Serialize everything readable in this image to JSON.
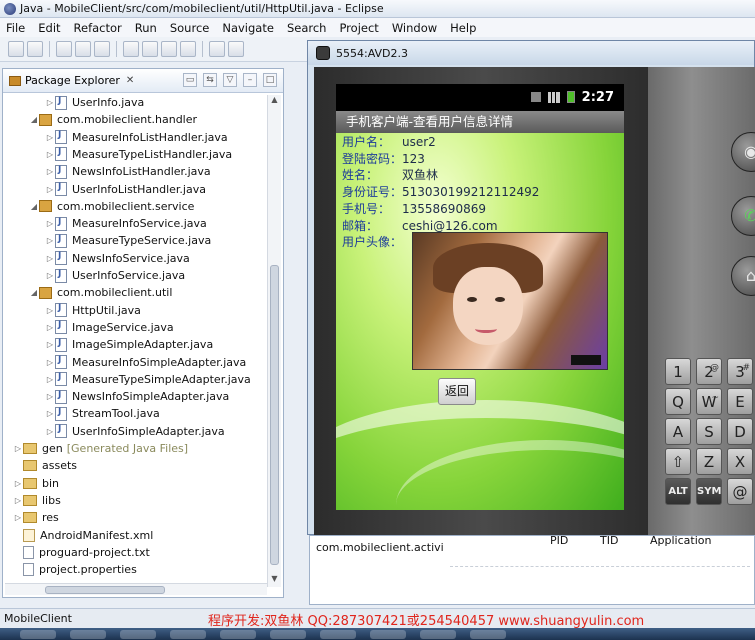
{
  "window": {
    "title": "Java - MobileClient/src/com/mobileclient/util/HttpUtil.java - Eclipse"
  },
  "menu": [
    "File",
    "Edit",
    "Refactor",
    "Run",
    "Source",
    "Navigate",
    "Search",
    "Project",
    "Window",
    "Help"
  ],
  "explorer": {
    "tab_label": "Package Explorer",
    "close_glyph": "✕",
    "items": [
      {
        "text": "UserInfo.java",
        "icon": "java-file-icon",
        "indent": 3
      },
      {
        "text": "com.mobileclient.handler",
        "icon": "package-icon",
        "indent": 2,
        "expanded": true
      },
      {
        "text": "MeasureInfoListHandler.java",
        "icon": "java-file-icon",
        "indent": 3
      },
      {
        "text": "MeasureTypeListHandler.java",
        "icon": "java-file-icon",
        "indent": 3
      },
      {
        "text": "NewsInfoListHandler.java",
        "icon": "java-file-icon",
        "indent": 3
      },
      {
        "text": "UserInfoListHandler.java",
        "icon": "java-file-icon",
        "indent": 3
      },
      {
        "text": "com.mobileclient.service",
        "icon": "package-icon",
        "indent": 2,
        "expanded": true
      },
      {
        "text": "MeasureInfoService.java",
        "icon": "java-file-icon",
        "indent": 3
      },
      {
        "text": "MeasureTypeService.java",
        "icon": "java-file-icon",
        "indent": 3
      },
      {
        "text": "NewsInfoService.java",
        "icon": "java-file-icon",
        "indent": 3
      },
      {
        "text": "UserInfoService.java",
        "icon": "java-file-icon",
        "indent": 3
      },
      {
        "text": "com.mobileclient.util",
        "icon": "package-icon",
        "indent": 2,
        "expanded": true
      },
      {
        "text": "HttpUtil.java",
        "icon": "java-file-icon",
        "indent": 3
      },
      {
        "text": "ImageService.java",
        "icon": "java-file-icon",
        "indent": 3
      },
      {
        "text": "ImageSimpleAdapter.java",
        "icon": "java-file-icon",
        "indent": 3
      },
      {
        "text": "MeasureInfoSimpleAdapter.java",
        "icon": "java-file-icon",
        "indent": 3
      },
      {
        "text": "MeasureTypeSimpleAdapter.java",
        "icon": "java-file-icon",
        "indent": 3
      },
      {
        "text": "NewsInfoSimpleAdapter.java",
        "icon": "java-file-icon",
        "indent": 3
      },
      {
        "text": "StreamTool.java",
        "icon": "java-file-icon",
        "indent": 3
      },
      {
        "text": "UserInfoSimpleAdapter.java",
        "icon": "java-file-icon",
        "indent": 3
      },
      {
        "text": "gen",
        "suffix": "[Generated Java Files]",
        "icon": "folder-icon",
        "indent": 1
      },
      {
        "text": "assets",
        "icon": "folder-icon",
        "indent": 1,
        "leaf": true
      },
      {
        "text": "bin",
        "icon": "folder-icon",
        "indent": 1
      },
      {
        "text": "libs",
        "icon": "folder-icon",
        "indent": 1
      },
      {
        "text": "res",
        "icon": "folder-icon",
        "indent": 1
      },
      {
        "text": "AndroidManifest.xml",
        "icon": "xml-file-icon",
        "indent": 1,
        "leaf": true
      },
      {
        "text": "proguard-project.txt",
        "icon": "text-file-icon",
        "indent": 1,
        "leaf": true
      },
      {
        "text": "project.properties",
        "icon": "text-file-icon",
        "indent": 1,
        "leaf": true
      }
    ]
  },
  "emulator": {
    "title": "5554:AVD2.3",
    "status_time": "2:27",
    "app_title": "手机客户端-查看用户信息详情",
    "fields": [
      {
        "label": "用户名：",
        "value": "user2"
      },
      {
        "label": "登陆密码：",
        "value": "123"
      },
      {
        "label": "姓名：",
        "value": "双鱼林"
      },
      {
        "label": "身份证号：",
        "value": "513030199212112492"
      },
      {
        "label": "手机号：",
        "value": "13558690869"
      },
      {
        "label": "邮箱：",
        "value": "ceshi@126.com"
      },
      {
        "label": "用户头像：",
        "value": ""
      }
    ],
    "back_button": "返回",
    "keys": [
      {
        "label": "1",
        "row": 0,
        "col": 0
      },
      {
        "label": "2",
        "row": 0,
        "col": 1,
        "sup": "@"
      },
      {
        "label": "3",
        "row": 0,
        "col": 2,
        "sup": "#"
      },
      {
        "label": "Q",
        "row": 1,
        "col": 0
      },
      {
        "label": "W",
        "row": 1,
        "col": 1,
        "sup": "~"
      },
      {
        "label": "E",
        "row": 1,
        "col": 2
      },
      {
        "label": "A",
        "row": 2,
        "col": 0
      },
      {
        "label": "S",
        "row": 2,
        "col": 1
      },
      {
        "label": "D",
        "row": 2,
        "col": 2
      },
      {
        "label": "⇧",
        "row": 3,
        "col": 0
      },
      {
        "label": "Z",
        "row": 3,
        "col": 1
      },
      {
        "label": "X",
        "row": 3,
        "col": 2
      },
      {
        "label": "ALT",
        "row": 4,
        "col": 0,
        "dark": true
      },
      {
        "label": "SYM",
        "row": 4,
        "col": 1,
        "dark": true
      },
      {
        "label": "@",
        "row": 4,
        "col": 2
      }
    ]
  },
  "lower_pane": {
    "context": "com.mobileclient.activi",
    "columns": [
      "PID",
      "TID",
      "Application"
    ]
  },
  "statusbar": {
    "app": "MobileClient",
    "credit": "程序开发:双鱼林 QQ:287307421或254540457 www.shuangyulin.com"
  }
}
